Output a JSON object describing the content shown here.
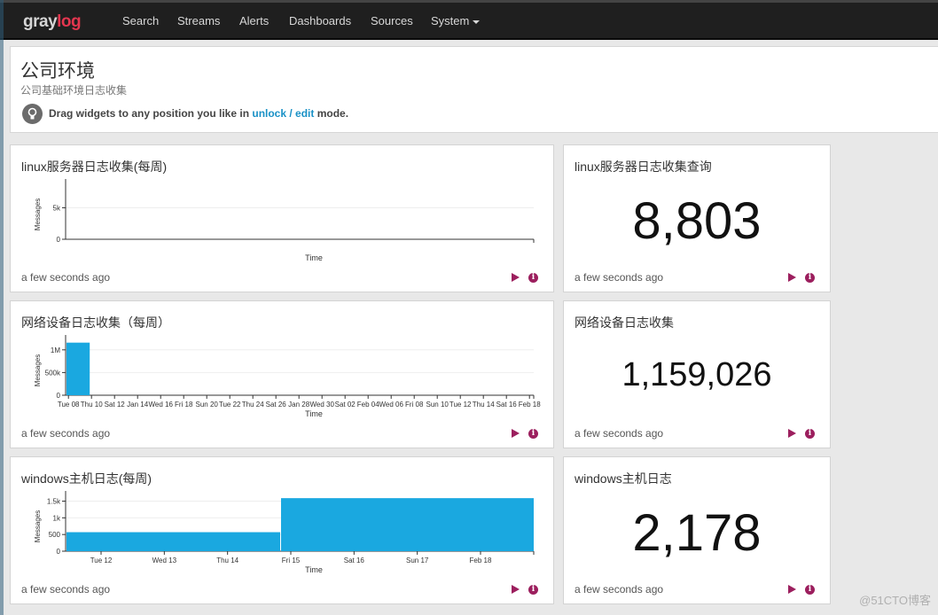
{
  "app": {
    "logo_part1": "gray",
    "logo_part2": "log"
  },
  "nav": {
    "items": [
      "Search",
      "Streams",
      "Alerts",
      "Dashboards",
      "Sources",
      "System"
    ]
  },
  "dashboard": {
    "title": "公司环境",
    "subtitle": "公司基础环境日志收集",
    "hint_prefix": "Drag widgets to any position you like in ",
    "hint_link": "unlock / edit",
    "hint_suffix": " mode."
  },
  "widgets": [
    {
      "title": "linux服务器日志收集(每周)",
      "time": "a few seconds ago",
      "chart_data": {
        "type": "area",
        "xlabel": "Time",
        "ylabel": "Messages",
        "y_ticks": [
          "0",
          "5k"
        ],
        "y_tick_values": [
          0,
          5000
        ],
        "ylim": [
          0,
          9000
        ],
        "x_ticks": [],
        "x": [],
        "series": [
          {
            "values": []
          }
        ],
        "grid": true
      }
    },
    {
      "title": "linux服务器日志收集查询",
      "time": "a few seconds ago",
      "value": "8,803"
    },
    {
      "title": "网络设备日志收集（每周）",
      "time": "a few seconds ago",
      "chart_data": {
        "type": "bar",
        "xlabel": "Time",
        "ylabel": "Messages",
        "y_ticks": [
          "0",
          "500k",
          "1M"
        ],
        "y_tick_values": [
          0,
          500000,
          1000000
        ],
        "ylim": [
          0,
          1250000
        ],
        "x_ticks": [
          "Tue 08",
          "Thu 10",
          "Sat 12",
          "Jan 14",
          "Wed 16",
          "Fri 18",
          "Sun 20",
          "Tue 22",
          "Thu 24",
          "Sat 26",
          "Jan 28",
          "Wed 30",
          "Sat 02",
          "Feb 04",
          "Wed 06",
          "Fri 08",
          "Sun 10",
          "Tue 12",
          "Thu 14",
          "Sat 16",
          "Feb 18"
        ],
        "bars": [
          {
            "from": "Tue 08",
            "to": "Thu 10",
            "value": 1159026
          }
        ],
        "grid": true
      }
    },
    {
      "title": "网络设备日志收集",
      "time": "a few seconds ago",
      "value": "1,159,026"
    },
    {
      "title": "windows主机日志(每周)",
      "time": "a few seconds ago",
      "chart_data": {
        "type": "area",
        "xlabel": "Time",
        "ylabel": "Messages",
        "y_ticks": [
          "0",
          "500",
          "1k",
          "1.5k"
        ],
        "y_tick_values": [
          0,
          500,
          1000,
          1500
        ],
        "ylim": [
          0,
          1700
        ],
        "x_ticks": [
          "Tue 12",
          "Wed 13",
          "Thu 14",
          "Fri 15",
          "Sat 16",
          "Sun 17",
          "Feb 18"
        ],
        "x": [
          "Tue 12",
          "Fri 15",
          "Feb 18"
        ],
        "series": [
          {
            "values": [
              570,
              1590,
              1590
            ]
          }
        ],
        "grid": true
      }
    },
    {
      "title": "windows主机日志",
      "time": "a few seconds ago",
      "value": "2,178"
    }
  ],
  "colors": {
    "navbar": "#1f1f1f",
    "accent": "#1a91c6",
    "chart_fill": "#1aa8e0",
    "action": "#9c1f5e"
  },
  "watermark": "@51CTO博客"
}
